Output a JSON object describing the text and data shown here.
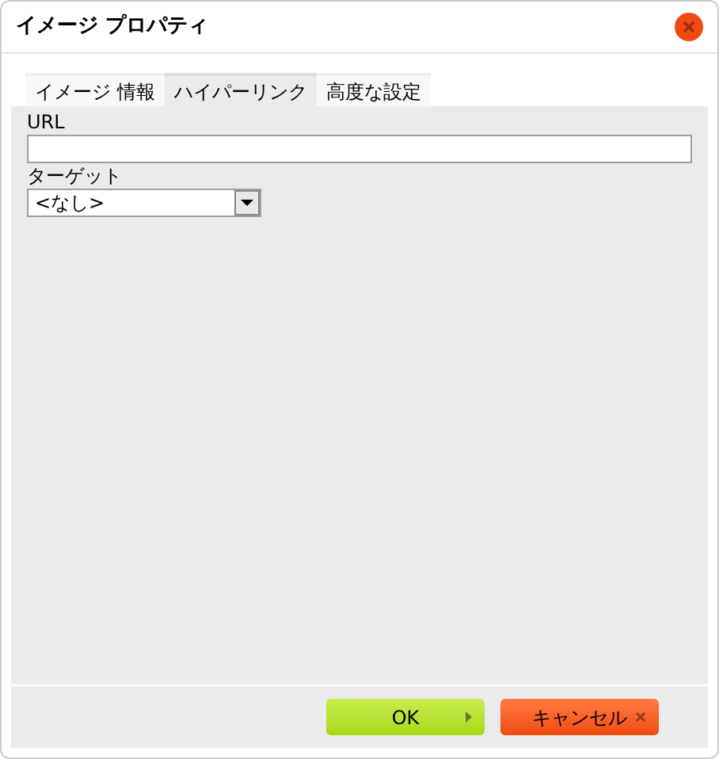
{
  "window": {
    "title": "イメージ プロパティ"
  },
  "tabs": [
    {
      "label": "イメージ 情報",
      "selected": false
    },
    {
      "label": "ハイパーリンク",
      "selected": true
    },
    {
      "label": "高度な設定",
      "selected": false
    }
  ],
  "fields": [
    {
      "kind": "text",
      "label": "URL"
    },
    {
      "kind": "select",
      "label": "ターゲット",
      "value": "<なし>"
    }
  ],
  "buttons": [
    {
      "kind": "ok",
      "label": "OK"
    },
    {
      "kind": "cancel",
      "label": "キャンセル"
    }
  ]
}
